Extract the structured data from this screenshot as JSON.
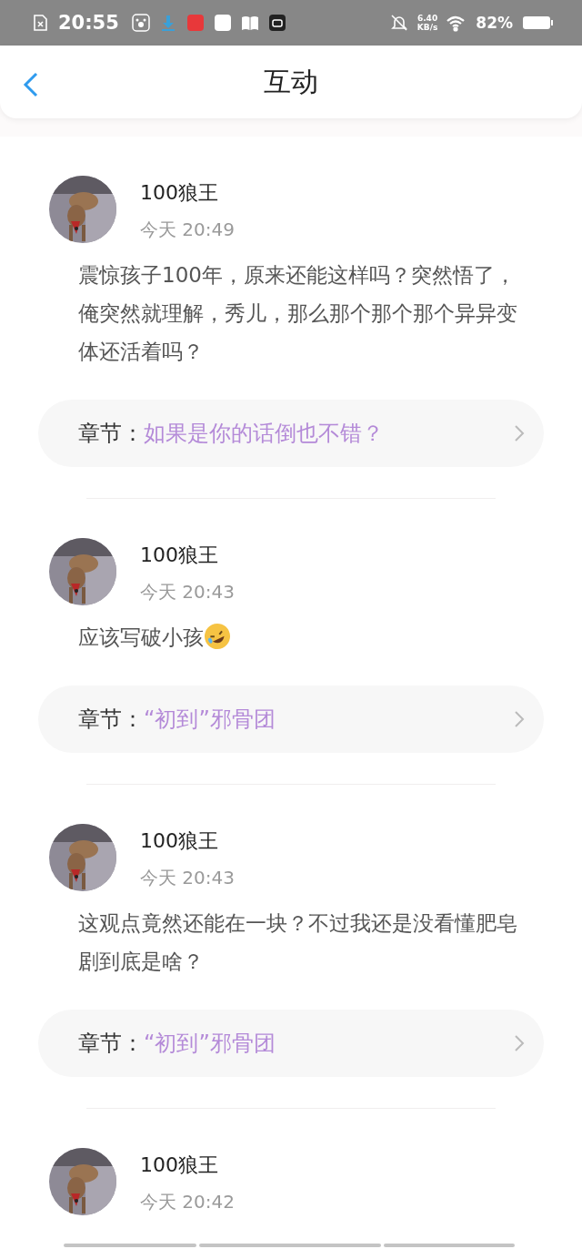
{
  "status_bar": {
    "time": "20:55",
    "net_speed": "6.40",
    "net_unit": "KB/s",
    "battery": "82%"
  },
  "header": {
    "title": "互动"
  },
  "comments": [
    {
      "user": "100狼王",
      "time": "今天 20:49",
      "text": "震惊孩子100年，原来还能这样吗？突然悟了，俺突然就理解，秀儿，那么那个那个那个异异变体还活着吗？",
      "laughing_emoji": false,
      "chapter_label": "章节：",
      "chapter_title": "如果是你的话倒也不错？"
    },
    {
      "user": "100狼王",
      "time": "今天 20:43",
      "text": "应该写破小孩",
      "laughing_emoji": true,
      "chapter_label": "章节：",
      "chapter_title": "“初到”邪骨团"
    },
    {
      "user": "100狼王",
      "time": "今天 20:43",
      "text": "这观点竟然还能在一块？不过我还是没看懂肥皂剧到底是啥？",
      "laughing_emoji": false,
      "chapter_label": "章节：",
      "chapter_title": "“初到”邪骨团"
    },
    {
      "user": "100狼王",
      "time": "今天 20:42"
    }
  ]
}
